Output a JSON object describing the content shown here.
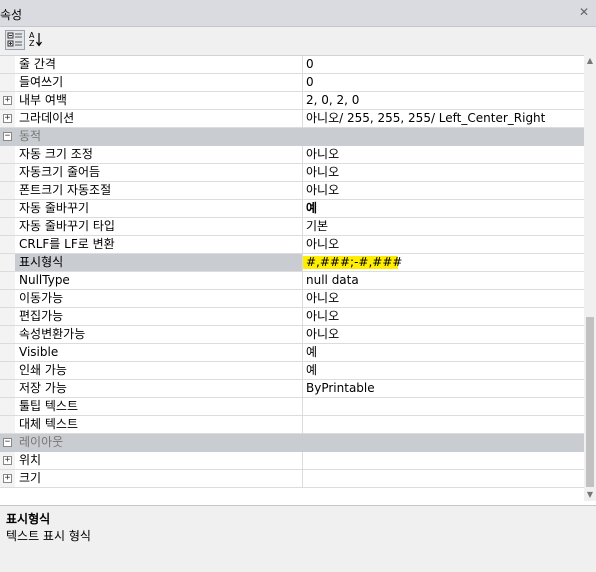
{
  "window": {
    "title": "속성",
    "close": "✕"
  },
  "toolbar": {
    "categorized_icon": "categorized-icon",
    "alphabetical_icon": "sort-alpha-icon"
  },
  "rows": [
    {
      "name": "줄 간격",
      "value": "0"
    },
    {
      "name": "들여쓰기",
      "value": "0"
    },
    {
      "name": "내부 여백",
      "value": "2, 0, 2, 0",
      "expander": "+"
    },
    {
      "name": "그라데이션",
      "value": "아니오/ 255, 255, 255/ Left_Center_Right",
      "expander": "+"
    },
    {
      "name": "동적",
      "category": true,
      "expander": "−"
    },
    {
      "name": "자동 크기 조정",
      "value": "아니오"
    },
    {
      "name": "자동크기 줄어듬",
      "value": "아니오"
    },
    {
      "name": "폰트크기 자동조절",
      "value": "아니오"
    },
    {
      "name": "자동 줄바꾸기",
      "value": "예",
      "bold": true
    },
    {
      "name": "자동 줄바꾸기 타입",
      "value": "기본"
    },
    {
      "name": "CRLF를 LF로 변환",
      "value": "아니오"
    },
    {
      "name": "표시형식",
      "value": "#,###;-#,###",
      "selected": true
    },
    {
      "name": "NullType",
      "value": "null data"
    },
    {
      "name": "이동가능",
      "value": "아니오"
    },
    {
      "name": "편집가능",
      "value": "아니오"
    },
    {
      "name": "속성변환가능",
      "value": "아니오"
    },
    {
      "name": "Visible",
      "value": "예"
    },
    {
      "name": "인쇄 가능",
      "value": "예"
    },
    {
      "name": "저장 가능",
      "value": "ByPrintable"
    },
    {
      "name": "툴팁 텍스트",
      "value": ""
    },
    {
      "name": "대체 텍스트",
      "value": ""
    },
    {
      "name": "레이아웃",
      "category": true,
      "expander": "−"
    },
    {
      "name": "위치",
      "value": "",
      "expander": "+"
    },
    {
      "name": "크기",
      "value": "",
      "expander": "+"
    }
  ],
  "description": {
    "title": "표시형식",
    "text": "텍스트 표시 형식"
  },
  "colors": {
    "selection": "#c9ccd0",
    "highlight": "#ffee00",
    "category_text": "#777777"
  }
}
